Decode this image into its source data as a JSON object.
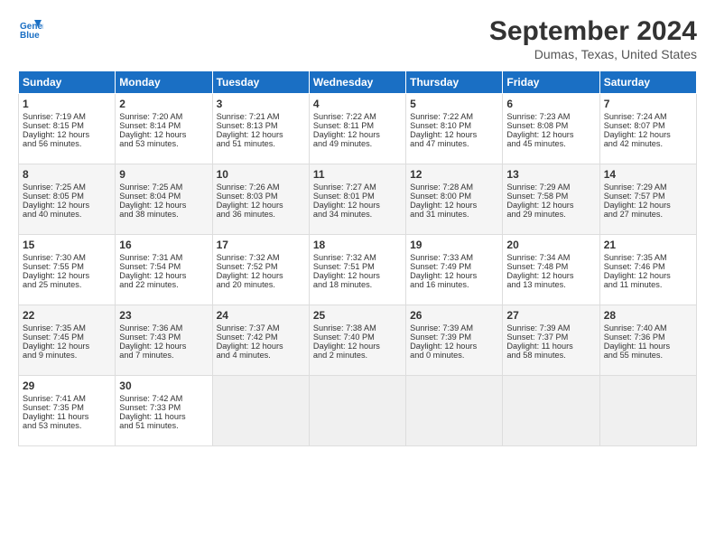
{
  "header": {
    "logo_line1": "General",
    "logo_line2": "Blue",
    "month_title": "September 2024",
    "location": "Dumas, Texas, United States"
  },
  "days_of_week": [
    "Sunday",
    "Monday",
    "Tuesday",
    "Wednesday",
    "Thursday",
    "Friday",
    "Saturday"
  ],
  "weeks": [
    [
      {
        "day": "1",
        "info": "Sunrise: 7:19 AM\nSunset: 8:15 PM\nDaylight: 12 hours\nand 56 minutes."
      },
      {
        "day": "2",
        "info": "Sunrise: 7:20 AM\nSunset: 8:14 PM\nDaylight: 12 hours\nand 53 minutes."
      },
      {
        "day": "3",
        "info": "Sunrise: 7:21 AM\nSunset: 8:13 PM\nDaylight: 12 hours\nand 51 minutes."
      },
      {
        "day": "4",
        "info": "Sunrise: 7:22 AM\nSunset: 8:11 PM\nDaylight: 12 hours\nand 49 minutes."
      },
      {
        "day": "5",
        "info": "Sunrise: 7:22 AM\nSunset: 8:10 PM\nDaylight: 12 hours\nand 47 minutes."
      },
      {
        "day": "6",
        "info": "Sunrise: 7:23 AM\nSunset: 8:08 PM\nDaylight: 12 hours\nand 45 minutes."
      },
      {
        "day": "7",
        "info": "Sunrise: 7:24 AM\nSunset: 8:07 PM\nDaylight: 12 hours\nand 42 minutes."
      }
    ],
    [
      {
        "day": "8",
        "info": "Sunrise: 7:25 AM\nSunset: 8:05 PM\nDaylight: 12 hours\nand 40 minutes."
      },
      {
        "day": "9",
        "info": "Sunrise: 7:25 AM\nSunset: 8:04 PM\nDaylight: 12 hours\nand 38 minutes."
      },
      {
        "day": "10",
        "info": "Sunrise: 7:26 AM\nSunset: 8:03 PM\nDaylight: 12 hours\nand 36 minutes."
      },
      {
        "day": "11",
        "info": "Sunrise: 7:27 AM\nSunset: 8:01 PM\nDaylight: 12 hours\nand 34 minutes."
      },
      {
        "day": "12",
        "info": "Sunrise: 7:28 AM\nSunset: 8:00 PM\nDaylight: 12 hours\nand 31 minutes."
      },
      {
        "day": "13",
        "info": "Sunrise: 7:29 AM\nSunset: 7:58 PM\nDaylight: 12 hours\nand 29 minutes."
      },
      {
        "day": "14",
        "info": "Sunrise: 7:29 AM\nSunset: 7:57 PM\nDaylight: 12 hours\nand 27 minutes."
      }
    ],
    [
      {
        "day": "15",
        "info": "Sunrise: 7:30 AM\nSunset: 7:55 PM\nDaylight: 12 hours\nand 25 minutes."
      },
      {
        "day": "16",
        "info": "Sunrise: 7:31 AM\nSunset: 7:54 PM\nDaylight: 12 hours\nand 22 minutes."
      },
      {
        "day": "17",
        "info": "Sunrise: 7:32 AM\nSunset: 7:52 PM\nDaylight: 12 hours\nand 20 minutes."
      },
      {
        "day": "18",
        "info": "Sunrise: 7:32 AM\nSunset: 7:51 PM\nDaylight: 12 hours\nand 18 minutes."
      },
      {
        "day": "19",
        "info": "Sunrise: 7:33 AM\nSunset: 7:49 PM\nDaylight: 12 hours\nand 16 minutes."
      },
      {
        "day": "20",
        "info": "Sunrise: 7:34 AM\nSunset: 7:48 PM\nDaylight: 12 hours\nand 13 minutes."
      },
      {
        "day": "21",
        "info": "Sunrise: 7:35 AM\nSunset: 7:46 PM\nDaylight: 12 hours\nand 11 minutes."
      }
    ],
    [
      {
        "day": "22",
        "info": "Sunrise: 7:35 AM\nSunset: 7:45 PM\nDaylight: 12 hours\nand 9 minutes."
      },
      {
        "day": "23",
        "info": "Sunrise: 7:36 AM\nSunset: 7:43 PM\nDaylight: 12 hours\nand 7 minutes."
      },
      {
        "day": "24",
        "info": "Sunrise: 7:37 AM\nSunset: 7:42 PM\nDaylight: 12 hours\nand 4 minutes."
      },
      {
        "day": "25",
        "info": "Sunrise: 7:38 AM\nSunset: 7:40 PM\nDaylight: 12 hours\nand 2 minutes."
      },
      {
        "day": "26",
        "info": "Sunrise: 7:39 AM\nSunset: 7:39 PM\nDaylight: 12 hours\nand 0 minutes."
      },
      {
        "day": "27",
        "info": "Sunrise: 7:39 AM\nSunset: 7:37 PM\nDaylight: 11 hours\nand 58 minutes."
      },
      {
        "day": "28",
        "info": "Sunrise: 7:40 AM\nSunset: 7:36 PM\nDaylight: 11 hours\nand 55 minutes."
      }
    ],
    [
      {
        "day": "29",
        "info": "Sunrise: 7:41 AM\nSunset: 7:35 PM\nDaylight: 11 hours\nand 53 minutes."
      },
      {
        "day": "30",
        "info": "Sunrise: 7:42 AM\nSunset: 7:33 PM\nDaylight: 11 hours\nand 51 minutes."
      },
      {
        "day": "",
        "info": ""
      },
      {
        "day": "",
        "info": ""
      },
      {
        "day": "",
        "info": ""
      },
      {
        "day": "",
        "info": ""
      },
      {
        "day": "",
        "info": ""
      }
    ]
  ]
}
